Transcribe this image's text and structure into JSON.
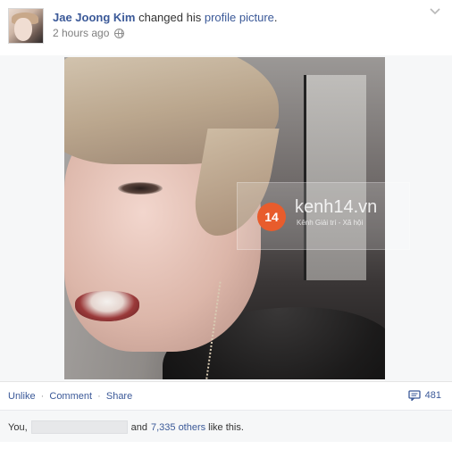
{
  "post": {
    "author": "Jae Joong Kim",
    "action": "changed his",
    "object_link": "profile picture",
    "period": ".",
    "timestamp": "2 hours ago",
    "privacy_icon": "globe-icon"
  },
  "photo": {
    "watermark_brand": "kenh14.vn",
    "watermark_logo": "14",
    "watermark_subtitle": "Kênh Giải trí - Xã hội"
  },
  "actions": {
    "unlike": "Unlike",
    "comment": "Comment",
    "share": "Share",
    "separator": "·",
    "comment_count": "481"
  },
  "likes": {
    "prefix": "You,",
    "middle": "and",
    "others": "7,335 others",
    "suffix": "like this."
  },
  "colors": {
    "link": "#3b5998",
    "muted": "#7f7f7f",
    "panel": "#f6f7f8"
  }
}
